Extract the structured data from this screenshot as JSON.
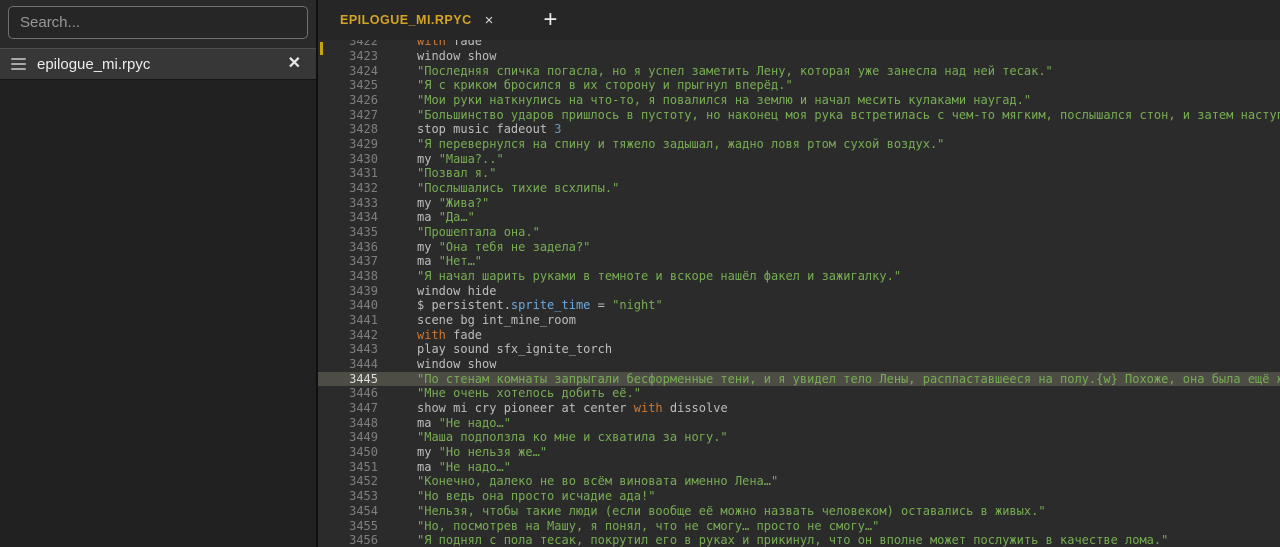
{
  "sidebar": {
    "search_placeholder": "Search...",
    "file_item": {
      "name": "epilogue_mi.rpyc"
    }
  },
  "icons": {
    "file_close": "✕",
    "tab_close": "×",
    "new_tab": "+"
  },
  "tabs": [
    {
      "label": "EPILOGUE_MI.RPYC"
    }
  ],
  "colors": {
    "accent_yellow": "#d5a324",
    "keyword_orange": "#cc7832",
    "string_green": "#77ad53",
    "field_blue": "#6fa8dc",
    "editor_bg": "#2b2b2b",
    "highlight_row": "#4d4d46"
  },
  "editor": {
    "highlighted_line": 3445,
    "lines": [
      {
        "n": 3422,
        "partial": true,
        "segs": [
          [
            "k",
            "with"
          ],
          [
            "p",
            " fade"
          ]
        ]
      },
      {
        "n": 3423,
        "segs": [
          [
            "p",
            "window show"
          ]
        ]
      },
      {
        "n": 3424,
        "segs": [
          [
            "s",
            "\"Последняя спичка погасла, но я успел заметить Лену, которая уже занесла над ней тесак.\""
          ]
        ]
      },
      {
        "n": 3425,
        "segs": [
          [
            "s",
            "\"Я с криком бросился в их сторону и прыгнул вперёд.\""
          ]
        ]
      },
      {
        "n": 3426,
        "segs": [
          [
            "s",
            "\"Мои руки наткнулись на что-то, я повалился на землю и начал месить кулаками наугад.\""
          ]
        ]
      },
      {
        "n": 3427,
        "segs": [
          [
            "s",
            "\"Большинство ударов пришлось в пустоту, но наконец моя рука встретилась с чем-то мягким, послышался стон, и затем наступила полная тишина.\""
          ]
        ]
      },
      {
        "n": 3428,
        "segs": [
          [
            "p",
            "stop music fadeout "
          ],
          [
            "n",
            "3"
          ]
        ]
      },
      {
        "n": 3429,
        "segs": [
          [
            "s",
            "\"Я перевернулся на спину и тяжело задышал, жадно ловя ртом сухой воздух.\""
          ]
        ]
      },
      {
        "n": 3430,
        "segs": [
          [
            "p",
            "my "
          ],
          [
            "s",
            "\"Маша?..\""
          ]
        ]
      },
      {
        "n": 3431,
        "segs": [
          [
            "s",
            "\"Позвал я.\""
          ]
        ]
      },
      {
        "n": 3432,
        "segs": [
          [
            "s",
            "\"Послышались тихие всхлипы.\""
          ]
        ]
      },
      {
        "n": 3433,
        "segs": [
          [
            "p",
            "my "
          ],
          [
            "s",
            "\"Жива?\""
          ]
        ]
      },
      {
        "n": 3434,
        "segs": [
          [
            "p",
            "ma "
          ],
          [
            "s",
            "\"Да…\""
          ]
        ]
      },
      {
        "n": 3435,
        "segs": [
          [
            "s",
            "\"Прошептала она.\""
          ]
        ]
      },
      {
        "n": 3436,
        "segs": [
          [
            "p",
            "my "
          ],
          [
            "s",
            "\"Она тебя не задела?\""
          ]
        ]
      },
      {
        "n": 3437,
        "segs": [
          [
            "p",
            "ma "
          ],
          [
            "s",
            "\"Нет…\""
          ]
        ]
      },
      {
        "n": 3438,
        "segs": [
          [
            "s",
            "\"Я начал шарить руками в темноте и вскоре нашёл факел и зажигалку.\""
          ]
        ]
      },
      {
        "n": 3439,
        "segs": [
          [
            "p",
            "window hide"
          ]
        ]
      },
      {
        "n": 3440,
        "segs": [
          [
            "p",
            "$ persistent."
          ],
          [
            "f",
            "sprite_time"
          ],
          [
            "p",
            " = "
          ],
          [
            "s",
            "\"night\""
          ]
        ]
      },
      {
        "n": 3441,
        "segs": [
          [
            "p",
            "scene bg int_mine_room"
          ]
        ]
      },
      {
        "n": 3442,
        "segs": [
          [
            "k",
            "with"
          ],
          [
            "p",
            " fade"
          ]
        ]
      },
      {
        "n": 3443,
        "segs": [
          [
            "p",
            "play sound sfx_ignite_torch"
          ]
        ]
      },
      {
        "n": 3444,
        "segs": [
          [
            "p",
            "window show"
          ]
        ]
      },
      {
        "n": 3445,
        "hl": true,
        "segs": [
          [
            "s",
            "\"По стенам комнаты запрыгали бесформенные тени, и я увидел тело Лены, распластавшееся на полу.{w} Похоже, она была ещё жива.\""
          ]
        ]
      },
      {
        "n": 3446,
        "segs": [
          [
            "s",
            "\"Мне очень хотелось добить её.\""
          ]
        ]
      },
      {
        "n": 3447,
        "segs": [
          [
            "p",
            "show mi cry pioneer at center "
          ],
          [
            "k",
            "with"
          ],
          [
            "p",
            " dissolve"
          ]
        ]
      },
      {
        "n": 3448,
        "segs": [
          [
            "p",
            "ma "
          ],
          [
            "s",
            "\"Не надо…\""
          ]
        ]
      },
      {
        "n": 3449,
        "segs": [
          [
            "s",
            "\"Маша подползла ко мне и схватила за ногу.\""
          ]
        ]
      },
      {
        "n": 3450,
        "segs": [
          [
            "p",
            "my "
          ],
          [
            "s",
            "\"Но нельзя же…\""
          ]
        ]
      },
      {
        "n": 3451,
        "segs": [
          [
            "p",
            "ma "
          ],
          [
            "s",
            "\"Не надо…\""
          ]
        ]
      },
      {
        "n": 3452,
        "segs": [
          [
            "s",
            "\"Конечно, далеко не во всём виновата именно Лена…\""
          ]
        ]
      },
      {
        "n": 3453,
        "segs": [
          [
            "s",
            "\"Но ведь она просто исчадие ада!\""
          ]
        ]
      },
      {
        "n": 3454,
        "segs": [
          [
            "s",
            "\"Нельзя, чтобы такие люди (если вообще её можно назвать человеком) оставались в живых.\""
          ]
        ]
      },
      {
        "n": 3455,
        "segs": [
          [
            "s",
            "\"Но, посмотрев на Машу, я понял, что не смогу… просто не смогу…\""
          ]
        ]
      },
      {
        "n": 3456,
        "segs": [
          [
            "s",
            "\"Я поднял с пола тесак, покрутил его в руках и прикинул, что он вполне может послужить в качестве лома.\""
          ]
        ]
      }
    ]
  }
}
